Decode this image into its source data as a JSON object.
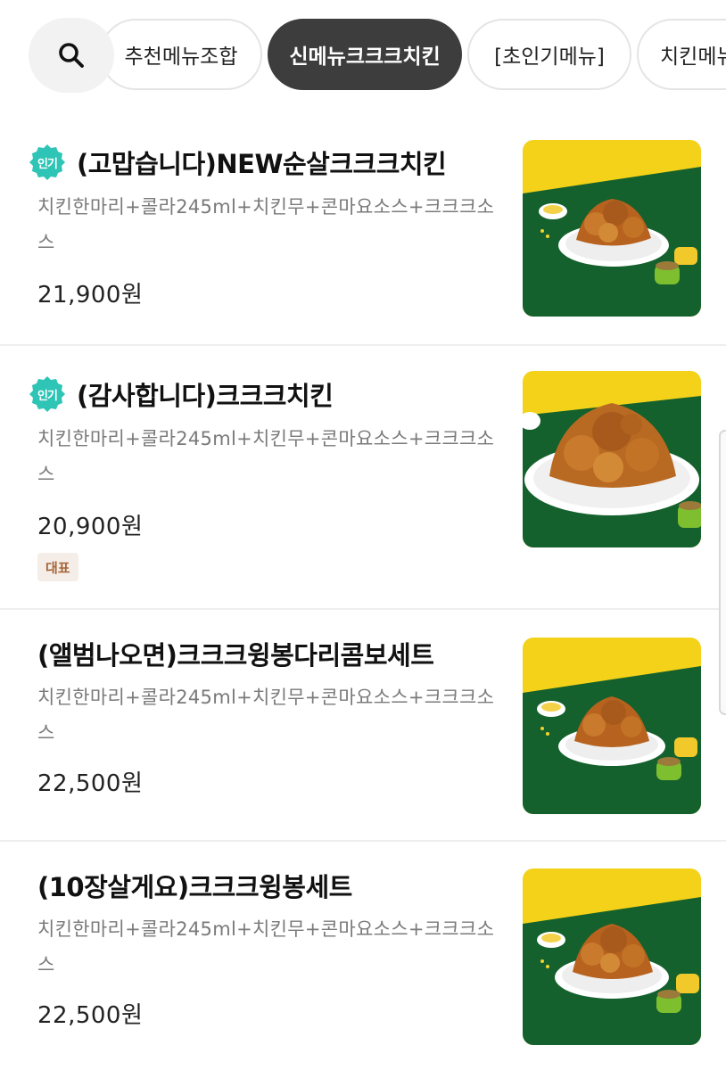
{
  "search": {
    "icon": "search-icon"
  },
  "tabs": [
    {
      "label": "추천메뉴조합",
      "active": false
    },
    {
      "label": "신메뉴크크크치킨",
      "active": true
    },
    {
      "label": "[초인기메뉴]",
      "active": false
    },
    {
      "label": "치킨메뉴",
      "active": false
    }
  ],
  "badges": {
    "popular": "인기",
    "representative": "대표"
  },
  "items": [
    {
      "name": "(고맙습니다)NEW순살크크크치킨",
      "desc": "치킨한마리+콜라245ml+치킨무+콘마요소스+크크크소스",
      "price": "21,900원",
      "popular": true
    },
    {
      "name": "(감사합니다)크크크치킨",
      "desc": "치킨한마리+콜라245ml+치킨무+콘마요소스+크크크소스",
      "price": "20,900원",
      "popular": true,
      "representative": true
    },
    {
      "name": "(앨범나오면)크크크윙봉다리콤보세트",
      "desc": "치킨한마리+콜라245ml+치킨무+콘마요소스+크크크소스",
      "price": "22,500원"
    },
    {
      "name": "(10장살게요)크크크윙봉세트",
      "desc": "치킨한마리+콜라245ml+치킨무+콘마요소스+크크크소스",
      "price": "22,500원"
    }
  ],
  "colors": {
    "popular_badge": "#2ec4b6",
    "active_tab": "#3d3d3d",
    "thumb_yellow": "#f4d21a",
    "thumb_green": "#14612d"
  }
}
